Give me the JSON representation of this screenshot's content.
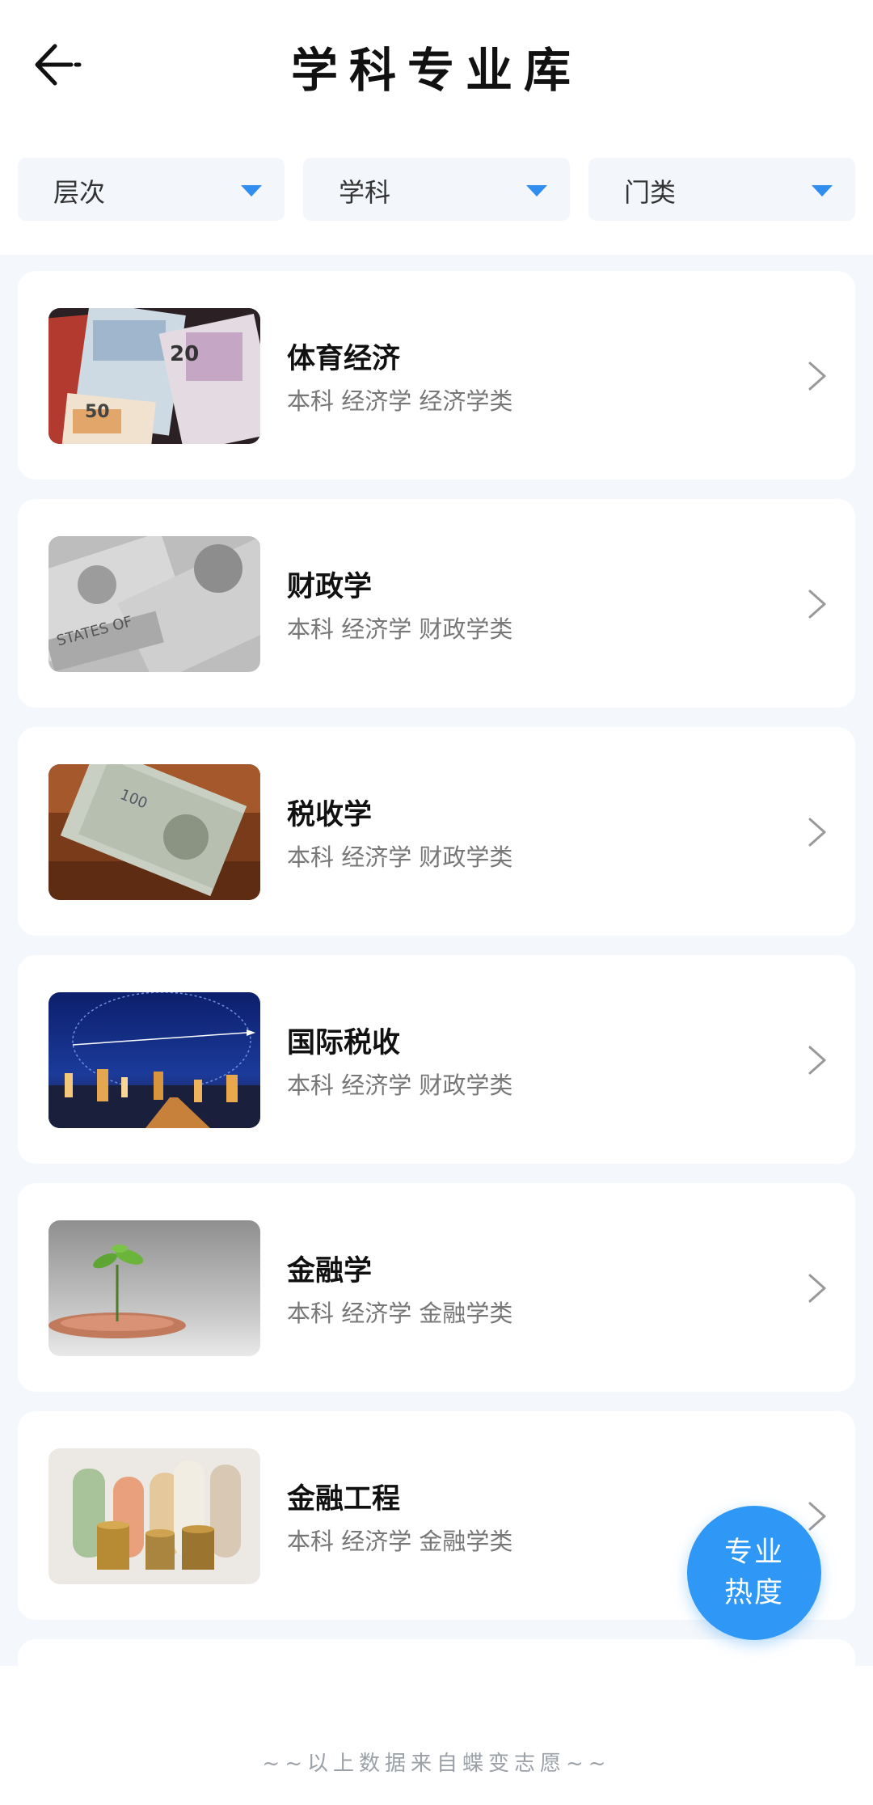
{
  "header": {
    "title": "学科专业库",
    "back_icon": "back-arrow-icon"
  },
  "filters": [
    {
      "label": "层次"
    },
    {
      "label": "学科"
    },
    {
      "label": "门类"
    }
  ],
  "majors": [
    {
      "name": "体育经济",
      "meta": "本科 经济学 经济学类",
      "image": "euro-banknotes"
    },
    {
      "name": "财政学",
      "meta": "本科 经济学 财政学类",
      "image": "dollar-bills-grayscale"
    },
    {
      "name": "税收学",
      "meta": "本科 经济学 财政学类",
      "image": "hundred-dollar-bills-on-wood"
    },
    {
      "name": "国际税收",
      "meta": "本科 经济学 财政学类",
      "image": "world-map-city-night"
    },
    {
      "name": "金融学",
      "meta": "本科 经济学 金融学类",
      "image": "sprout-from-coins"
    },
    {
      "name": "金融工程",
      "meta": "本科 经济学 金融学类",
      "image": "rolled-banknotes-coin-stacks"
    }
  ],
  "fab": {
    "line1": "专业",
    "line2": "热度"
  },
  "footer": {
    "note": "~~以上数据来自蝶变志愿~~"
  },
  "colors": {
    "accent": "#2f97f5",
    "list_bg": "#f4f7fb",
    "filter_bg": "#f3f6fb"
  }
}
